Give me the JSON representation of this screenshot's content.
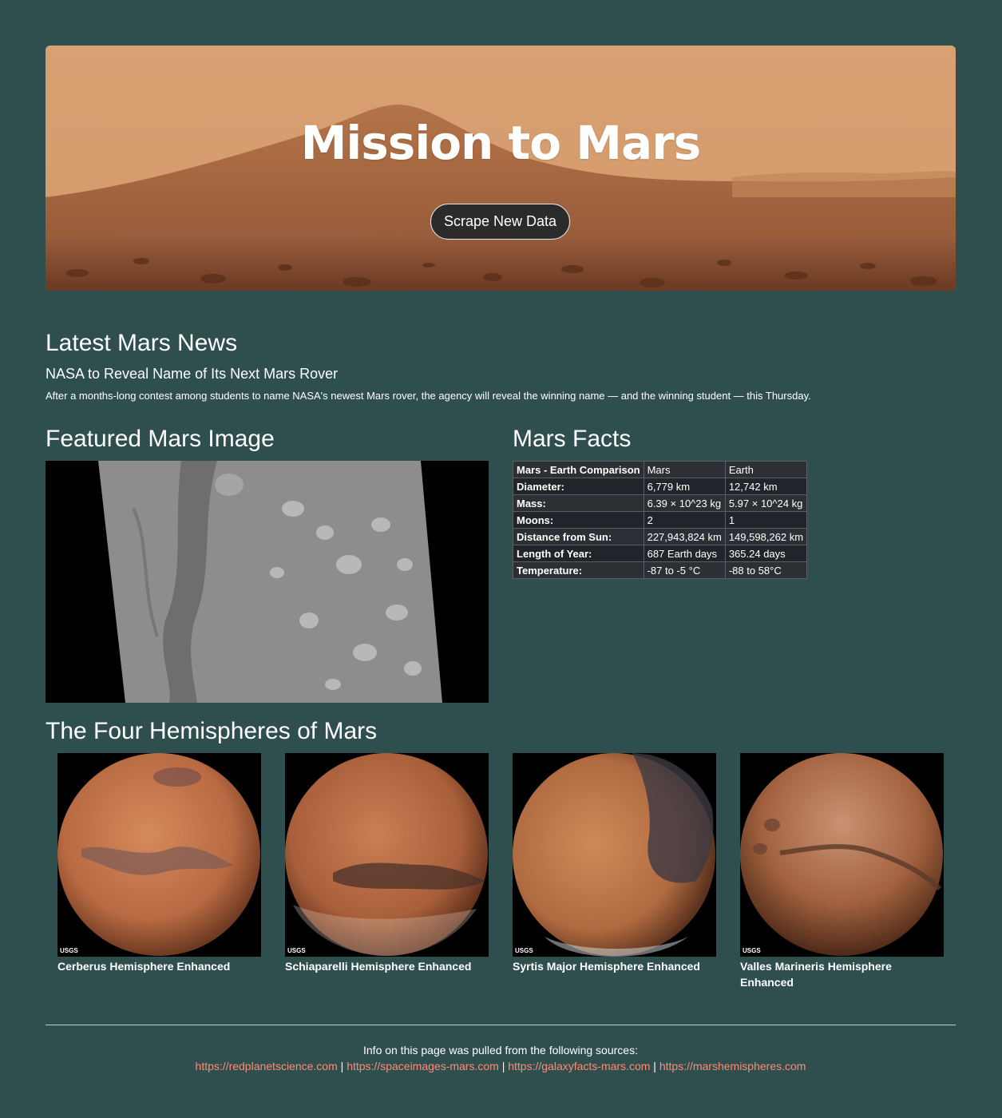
{
  "hero": {
    "title": "Mission to Mars",
    "button_label": "Scrape New Data"
  },
  "news": {
    "section_title": "Latest Mars News",
    "headline": "NASA to Reveal Name of Its Next Mars Rover",
    "teaser": "After a months-long contest among students to name NASA's newest Mars rover, the agency will reveal the winning name — and the winning student — this Thursday."
  },
  "featured": {
    "section_title": "Featured Mars Image"
  },
  "facts": {
    "section_title": "Mars Facts",
    "header": [
      "Mars - Earth Comparison",
      "Mars",
      "Earth"
    ],
    "rows": [
      [
        "Diameter:",
        "6,779 km",
        "12,742 km"
      ],
      [
        "Mass:",
        "6.39 × 10^23 kg",
        "5.97 × 10^24 kg"
      ],
      [
        "Moons:",
        "2",
        "1"
      ],
      [
        "Distance from Sun:",
        "227,943,824 km",
        "149,598,262 km"
      ],
      [
        "Length of Year:",
        "687 Earth days",
        "365.24 days"
      ],
      [
        "Temperature:",
        "-87 to -5 °C",
        "-88 to 58°C"
      ]
    ]
  },
  "hemispheres": {
    "section_title": "The Four Hemispheres of Mars",
    "items": [
      {
        "title": "Cerberus Hemisphere Enhanced",
        "image_label": "USGS"
      },
      {
        "title": "Schiaparelli Hemisphere Enhanced",
        "image_label": "USGS"
      },
      {
        "title": "Syrtis Major Hemisphere Enhanced",
        "image_label": "USGS"
      },
      {
        "title": "Valles Marineris Hemisphere Enhanced",
        "image_label": "USGS"
      }
    ]
  },
  "footer": {
    "text": "Info on this page was pulled from the following sources:",
    "links": [
      "https://redplanetscience.com",
      "https://spaceimages-mars.com",
      "https://galaxyfacts-mars.com",
      "https://marshemispheres.com"
    ],
    "separator": "|"
  },
  "colors": {
    "background": "#2f4f4f",
    "link": "#ff8a72",
    "button": "#2b2b2b"
  }
}
